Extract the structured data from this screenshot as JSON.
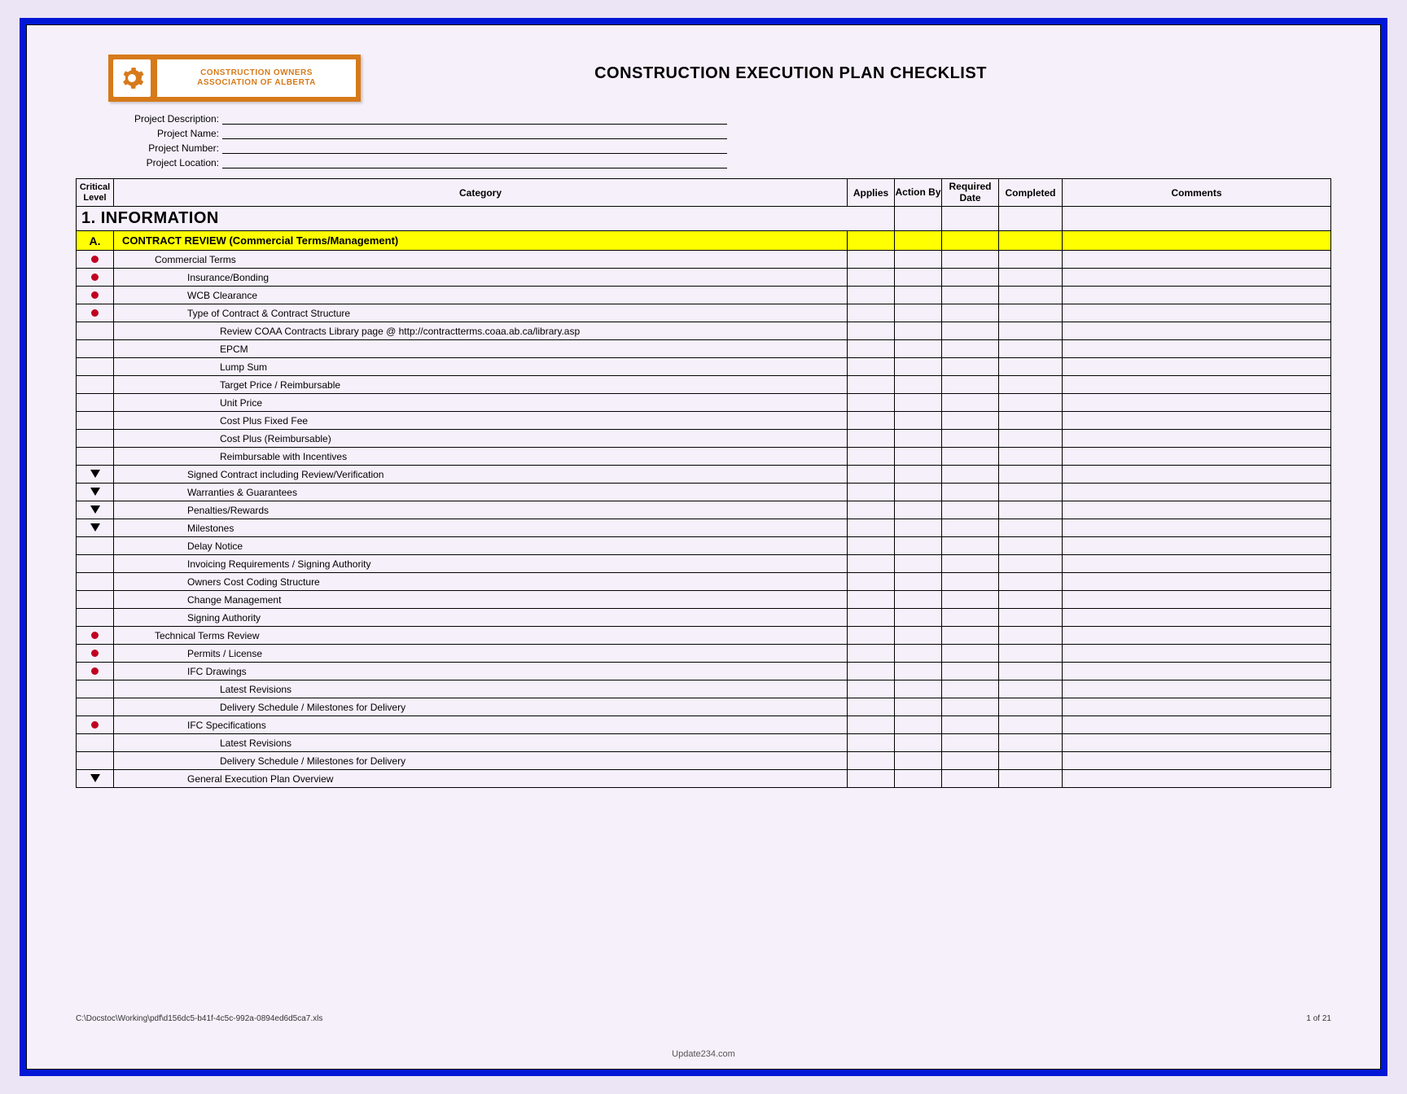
{
  "logo": {
    "line1": "CONSTRUCTION OWNERS",
    "line2": "ASSOCIATION OF ALBERTA"
  },
  "title": "CONSTRUCTION EXECUTION PLAN CHECKLIST",
  "meta": {
    "rows": [
      "Project Description:",
      "Project Name:",
      "Project Number:",
      "Project Location:"
    ]
  },
  "columns": {
    "critical": "Critical Level",
    "category": "Category",
    "applies": "Applies",
    "action_by": "Action By",
    "required_date": "Required Date",
    "completed": "Completed",
    "comments": "Comments"
  },
  "section": {
    "number": "1.",
    "title": "INFORMATION"
  },
  "subsection": {
    "letter": "A.",
    "title": "CONTRACT REVIEW (Commercial Terms/Management)"
  },
  "rows": [
    {
      "crit": "dot",
      "indent": 1,
      "text": "Commercial Terms"
    },
    {
      "crit": "dot",
      "indent": 2,
      "text": "Insurance/Bonding"
    },
    {
      "crit": "dot",
      "indent": 2,
      "text": "WCB Clearance"
    },
    {
      "crit": "dot",
      "indent": 2,
      "text": "Type of Contract & Contract Structure"
    },
    {
      "crit": "",
      "indent": 3,
      "text": "Review COAA Contracts Library page @ http://contractterms.coaa.ab.ca/library.asp"
    },
    {
      "crit": "",
      "indent": 3,
      "text": "EPCM"
    },
    {
      "crit": "",
      "indent": 3,
      "text": "Lump Sum"
    },
    {
      "crit": "",
      "indent": 3,
      "text": "Target Price / Reimbursable"
    },
    {
      "crit": "",
      "indent": 3,
      "text": "Unit Price"
    },
    {
      "crit": "",
      "indent": 3,
      "text": "Cost Plus Fixed Fee"
    },
    {
      "crit": "",
      "indent": 3,
      "text": "Cost Plus (Reimbursable)"
    },
    {
      "crit": "",
      "indent": 3,
      "text": "Reimbursable with Incentives"
    },
    {
      "crit": "tri",
      "indent": 2,
      "text": "Signed Contract including Review/Verification"
    },
    {
      "crit": "tri",
      "indent": 2,
      "text": "Warranties & Guarantees"
    },
    {
      "crit": "tri",
      "indent": 2,
      "text": "Penalties/Rewards"
    },
    {
      "crit": "tri",
      "indent": 2,
      "text": "Milestones"
    },
    {
      "crit": "",
      "indent": 2,
      "text": "Delay Notice"
    },
    {
      "crit": "",
      "indent": 2,
      "text": "Invoicing Requirements / Signing Authority"
    },
    {
      "crit": "",
      "indent": 2,
      "text": "Owners Cost Coding Structure"
    },
    {
      "crit": "",
      "indent": 2,
      "text": "Change Management"
    },
    {
      "crit": "",
      "indent": 2,
      "text": "Signing Authority"
    },
    {
      "crit": "dot",
      "indent": 1,
      "text": "Technical Terms Review"
    },
    {
      "crit": "dot",
      "indent": 2,
      "text": "Permits / License"
    },
    {
      "crit": "dot",
      "indent": 2,
      "text": "IFC Drawings"
    },
    {
      "crit": "",
      "indent": 3,
      "text": "Latest Revisions"
    },
    {
      "crit": "",
      "indent": 3,
      "text": "Delivery Schedule / Milestones for Delivery"
    },
    {
      "crit": "dot",
      "indent": 2,
      "text": "IFC Specifications"
    },
    {
      "crit": "",
      "indent": 3,
      "text": "Latest Revisions"
    },
    {
      "crit": "",
      "indent": 3,
      "text": "Delivery Schedule / Milestones for Delivery"
    },
    {
      "crit": "tri",
      "indent": 2,
      "text": "General Execution Plan Overview"
    }
  ],
  "footer": {
    "path": "C:\\Docstoc\\Working\\pdf\\d156dc5-b41f-4c5c-992a-0894ed6d5ca7.xls",
    "page": "1 of 21"
  },
  "watermark": "Update234.com"
}
